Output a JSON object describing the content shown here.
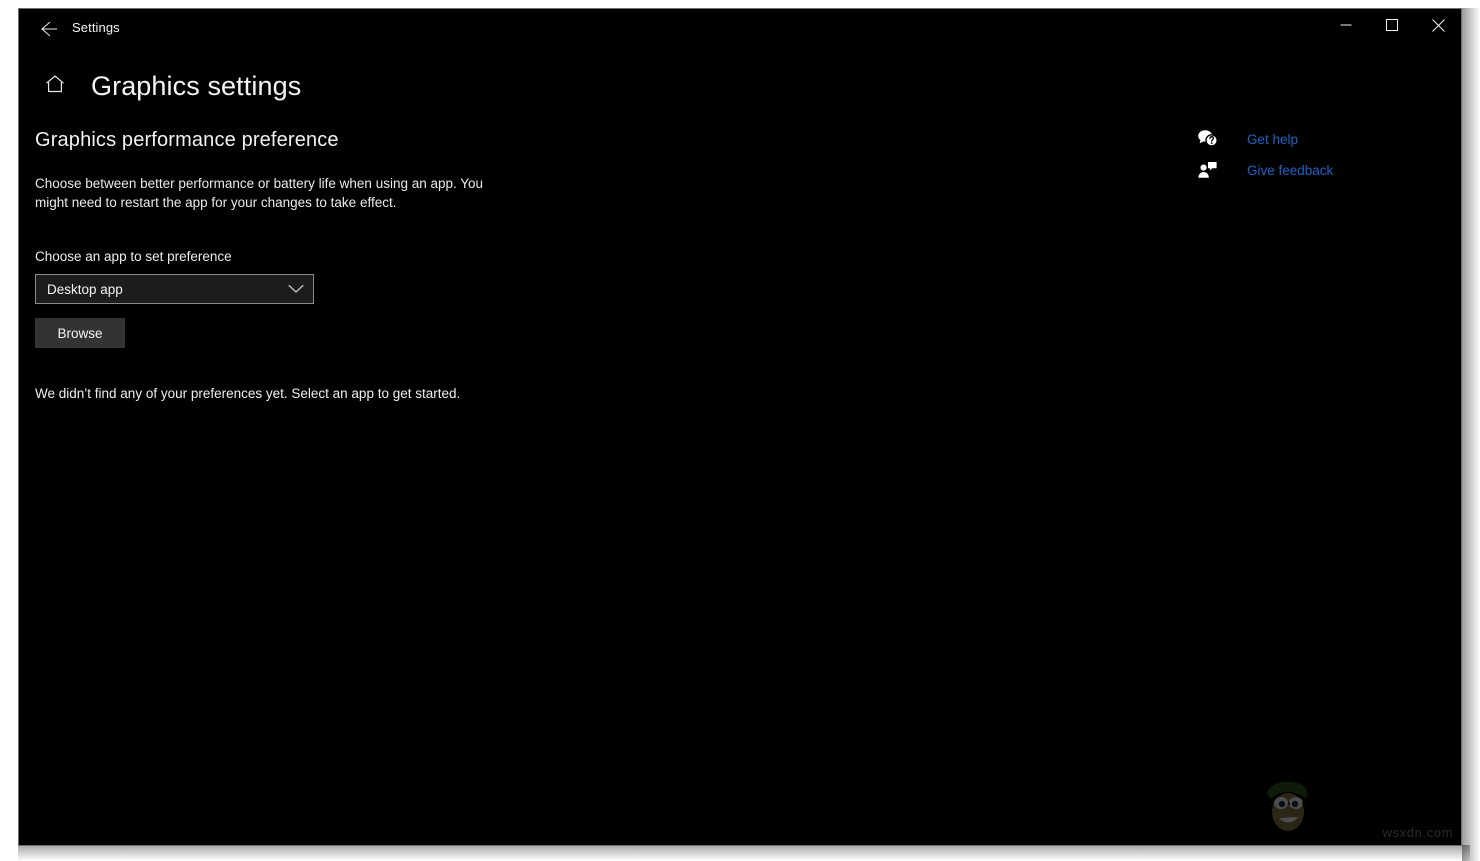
{
  "window": {
    "titlebar": {
      "back_icon": "back-arrow-icon",
      "app_title": "Settings",
      "minimize_label": "minimize-icon",
      "maximize_label": "maximize-icon",
      "close_label": "close-icon"
    },
    "header": {
      "home_icon": "home-icon",
      "page_title": "Graphics settings"
    }
  },
  "main": {
    "section_heading": "Graphics performance preference",
    "description": "Choose between better performance or battery life when using an app. You might need to restart the app for your changes to take effect.",
    "field_label": "Choose an app to set preference",
    "app_type_select": {
      "value": "Desktop app",
      "chevron_icon": "chevron-down-icon"
    },
    "browse_label": "Browse",
    "empty_state": "We didn’t find any of your preferences yet. Select an app to get started."
  },
  "rail": {
    "links": [
      {
        "label": "Get help",
        "icon": "help-bubble-icon"
      },
      {
        "label": "Give feedback",
        "icon": "feedback-person-icon"
      }
    ]
  },
  "watermark": {
    "text": "wsxdn.com",
    "logo": "site-mascot-logo"
  },
  "colors": {
    "window_bg": "#000000",
    "window_border": "#6f6f6f",
    "text_primary": "#f2f2f2",
    "link_blue": "#1d63c4",
    "button_bg": "#333333",
    "combo_border": "#8a8a8a",
    "page_bg": "#ffffff"
  }
}
